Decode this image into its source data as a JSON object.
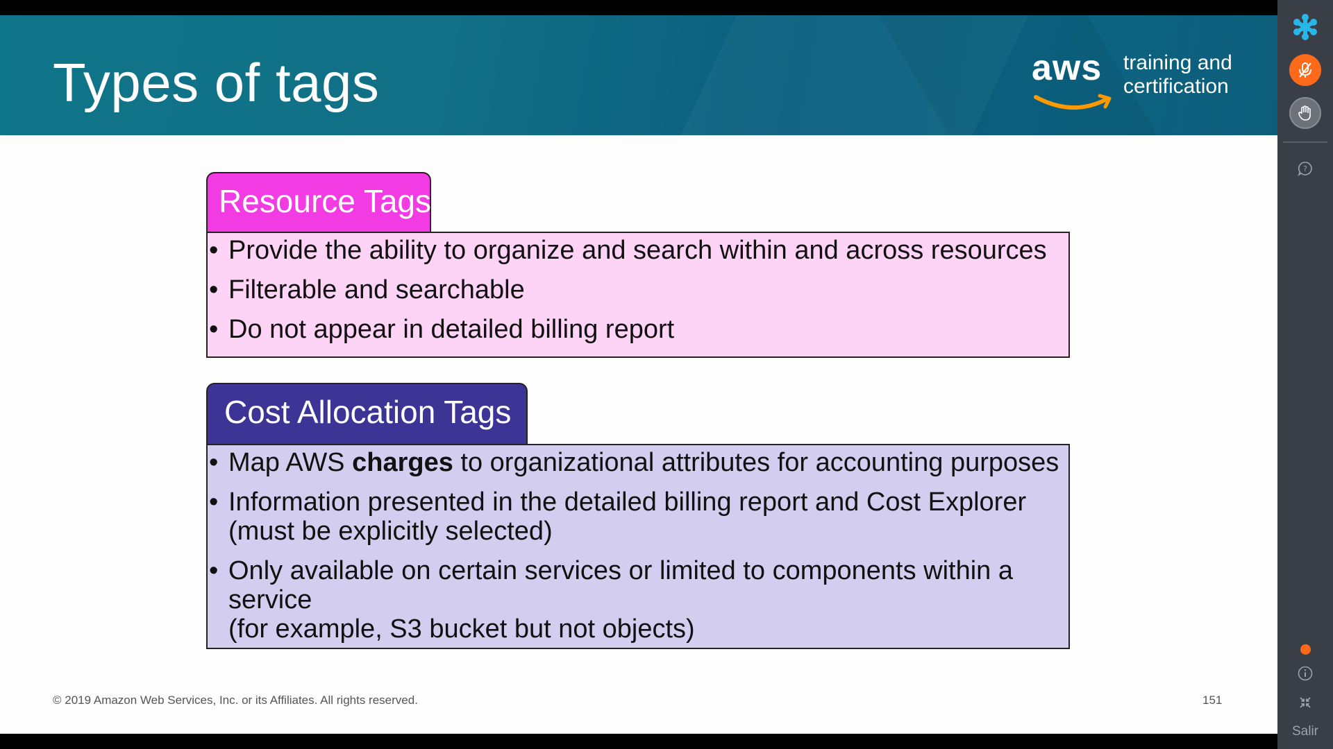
{
  "slide": {
    "title": "Types of tags",
    "logo_text": "aws",
    "tagline_line1": "training and",
    "tagline_line2": "certification",
    "footer_copyright": "© 2019 Amazon Web Services, Inc. or its Affiliates. All rights reserved.",
    "page_number": "151"
  },
  "resource_tags": {
    "heading": "Resource Tags",
    "bullets": [
      "Provide the ability to organize and search within and across resources",
      "Filterable and searchable",
      "Do not appear in detailed billing report"
    ],
    "tab_color": "#f23be2",
    "box_color": "#fdd3f6"
  },
  "cost_allocation_tags": {
    "heading": "Cost Allocation Tags",
    "bullet1_before": "Map AWS ",
    "bullet1_bold": "charges",
    "bullet1_after": " to organizational attributes for accounting purposes",
    "bullet2_line1": "Information presented in the detailed billing report and Cost Explorer",
    "bullet2_line2": "(must be explicitly selected)",
    "bullet3_line1": "Only available on certain services or limited to components within a",
    "bullet3_line2": "service",
    "bullet3_line3": "(for example, S3 bucket but not objects)",
    "tab_color": "#3c3595",
    "box_color": "#d3cdef"
  },
  "sidebar": {
    "icons": [
      "asterisk-logo-icon",
      "microphone-icon",
      "raise-hand-icon",
      "help-icon",
      "status-dot-icon",
      "info-icon",
      "collapse-icon"
    ],
    "exit_label": "Salir",
    "accent_color": "#ff6a1a"
  }
}
